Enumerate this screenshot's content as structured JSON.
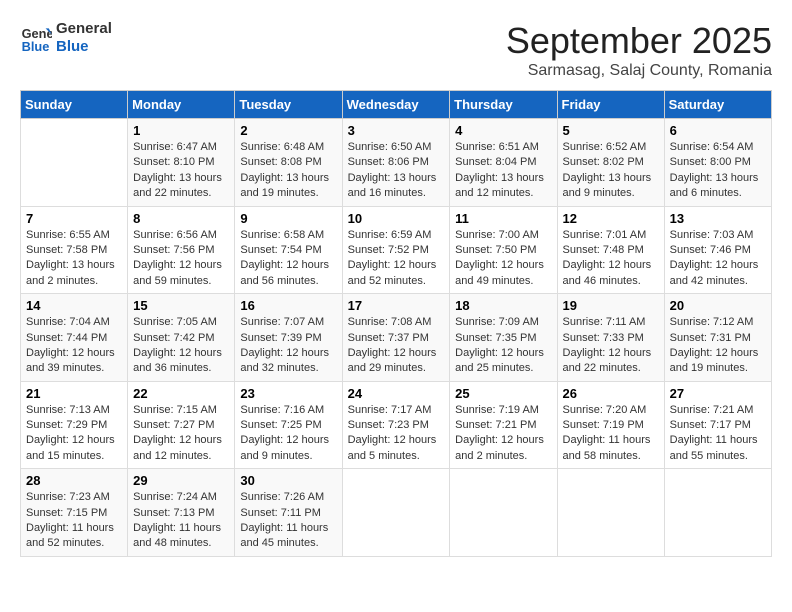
{
  "header": {
    "logo_text_general": "General",
    "logo_text_blue": "Blue",
    "month": "September 2025",
    "location": "Sarmasag, Salaj County, Romania"
  },
  "weekdays": [
    "Sunday",
    "Monday",
    "Tuesday",
    "Wednesday",
    "Thursday",
    "Friday",
    "Saturday"
  ],
  "weeks": [
    [
      {
        "day": "",
        "info": ""
      },
      {
        "day": "1",
        "info": "Sunrise: 6:47 AM\nSunset: 8:10 PM\nDaylight: 13 hours\nand 22 minutes."
      },
      {
        "day": "2",
        "info": "Sunrise: 6:48 AM\nSunset: 8:08 PM\nDaylight: 13 hours\nand 19 minutes."
      },
      {
        "day": "3",
        "info": "Sunrise: 6:50 AM\nSunset: 8:06 PM\nDaylight: 13 hours\nand 16 minutes."
      },
      {
        "day": "4",
        "info": "Sunrise: 6:51 AM\nSunset: 8:04 PM\nDaylight: 13 hours\nand 12 minutes."
      },
      {
        "day": "5",
        "info": "Sunrise: 6:52 AM\nSunset: 8:02 PM\nDaylight: 13 hours\nand 9 minutes."
      },
      {
        "day": "6",
        "info": "Sunrise: 6:54 AM\nSunset: 8:00 PM\nDaylight: 13 hours\nand 6 minutes."
      }
    ],
    [
      {
        "day": "7",
        "info": "Sunrise: 6:55 AM\nSunset: 7:58 PM\nDaylight: 13 hours\nand 2 minutes."
      },
      {
        "day": "8",
        "info": "Sunrise: 6:56 AM\nSunset: 7:56 PM\nDaylight: 12 hours\nand 59 minutes."
      },
      {
        "day": "9",
        "info": "Sunrise: 6:58 AM\nSunset: 7:54 PM\nDaylight: 12 hours\nand 56 minutes."
      },
      {
        "day": "10",
        "info": "Sunrise: 6:59 AM\nSunset: 7:52 PM\nDaylight: 12 hours\nand 52 minutes."
      },
      {
        "day": "11",
        "info": "Sunrise: 7:00 AM\nSunset: 7:50 PM\nDaylight: 12 hours\nand 49 minutes."
      },
      {
        "day": "12",
        "info": "Sunrise: 7:01 AM\nSunset: 7:48 PM\nDaylight: 12 hours\nand 46 minutes."
      },
      {
        "day": "13",
        "info": "Sunrise: 7:03 AM\nSunset: 7:46 PM\nDaylight: 12 hours\nand 42 minutes."
      }
    ],
    [
      {
        "day": "14",
        "info": "Sunrise: 7:04 AM\nSunset: 7:44 PM\nDaylight: 12 hours\nand 39 minutes."
      },
      {
        "day": "15",
        "info": "Sunrise: 7:05 AM\nSunset: 7:42 PM\nDaylight: 12 hours\nand 36 minutes."
      },
      {
        "day": "16",
        "info": "Sunrise: 7:07 AM\nSunset: 7:39 PM\nDaylight: 12 hours\nand 32 minutes."
      },
      {
        "day": "17",
        "info": "Sunrise: 7:08 AM\nSunset: 7:37 PM\nDaylight: 12 hours\nand 29 minutes."
      },
      {
        "day": "18",
        "info": "Sunrise: 7:09 AM\nSunset: 7:35 PM\nDaylight: 12 hours\nand 25 minutes."
      },
      {
        "day": "19",
        "info": "Sunrise: 7:11 AM\nSunset: 7:33 PM\nDaylight: 12 hours\nand 22 minutes."
      },
      {
        "day": "20",
        "info": "Sunrise: 7:12 AM\nSunset: 7:31 PM\nDaylight: 12 hours\nand 19 minutes."
      }
    ],
    [
      {
        "day": "21",
        "info": "Sunrise: 7:13 AM\nSunset: 7:29 PM\nDaylight: 12 hours\nand 15 minutes."
      },
      {
        "day": "22",
        "info": "Sunrise: 7:15 AM\nSunset: 7:27 PM\nDaylight: 12 hours\nand 12 minutes."
      },
      {
        "day": "23",
        "info": "Sunrise: 7:16 AM\nSunset: 7:25 PM\nDaylight: 12 hours\nand 9 minutes."
      },
      {
        "day": "24",
        "info": "Sunrise: 7:17 AM\nSunset: 7:23 PM\nDaylight: 12 hours\nand 5 minutes."
      },
      {
        "day": "25",
        "info": "Sunrise: 7:19 AM\nSunset: 7:21 PM\nDaylight: 12 hours\nand 2 minutes."
      },
      {
        "day": "26",
        "info": "Sunrise: 7:20 AM\nSunset: 7:19 PM\nDaylight: 11 hours\nand 58 minutes."
      },
      {
        "day": "27",
        "info": "Sunrise: 7:21 AM\nSunset: 7:17 PM\nDaylight: 11 hours\nand 55 minutes."
      }
    ],
    [
      {
        "day": "28",
        "info": "Sunrise: 7:23 AM\nSunset: 7:15 PM\nDaylight: 11 hours\nand 52 minutes."
      },
      {
        "day": "29",
        "info": "Sunrise: 7:24 AM\nSunset: 7:13 PM\nDaylight: 11 hours\nand 48 minutes."
      },
      {
        "day": "30",
        "info": "Sunrise: 7:26 AM\nSunset: 7:11 PM\nDaylight: 11 hours\nand 45 minutes."
      },
      {
        "day": "",
        "info": ""
      },
      {
        "day": "",
        "info": ""
      },
      {
        "day": "",
        "info": ""
      },
      {
        "day": "",
        "info": ""
      }
    ]
  ]
}
